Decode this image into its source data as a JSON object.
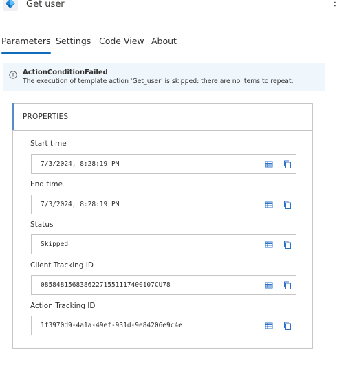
{
  "header": {
    "title": "Get user",
    "more_label": "⋮"
  },
  "tabs": [
    {
      "label": "Parameters",
      "active": true
    },
    {
      "label": "Settings",
      "active": false
    },
    {
      "label": "Code View",
      "active": false
    },
    {
      "label": "About",
      "active": false
    }
  ],
  "banner": {
    "title": "ActionConditionFailed",
    "message": "The execution of template action 'Get_user' is skipped: there are no items to repeat."
  },
  "properties": {
    "heading": "PROPERTIES",
    "fields": [
      {
        "label": "Start time",
        "value": "7/3/2024, 8:28:19 PM"
      },
      {
        "label": "End time",
        "value": "7/3/2024, 8:28:19 PM"
      },
      {
        "label": "Status",
        "value": "Skipped"
      },
      {
        "label": "Client Tracking ID",
        "value": "08584815683862271551117400107CU78"
      },
      {
        "label": "Action Tracking ID",
        "value": "1f3970d9-4a1a-49ef-931d-9e84206e9c4e"
      }
    ]
  },
  "colors": {
    "accent": "#0f6cbd",
    "banner_bg": "#eff6fc",
    "icon_blue": "#2b73c9"
  },
  "icons": {
    "app": "azure-ad-diamond-icon",
    "info": "info-circle-icon",
    "field_action_1": "table-view-icon",
    "field_action_2": "copy-icon"
  }
}
